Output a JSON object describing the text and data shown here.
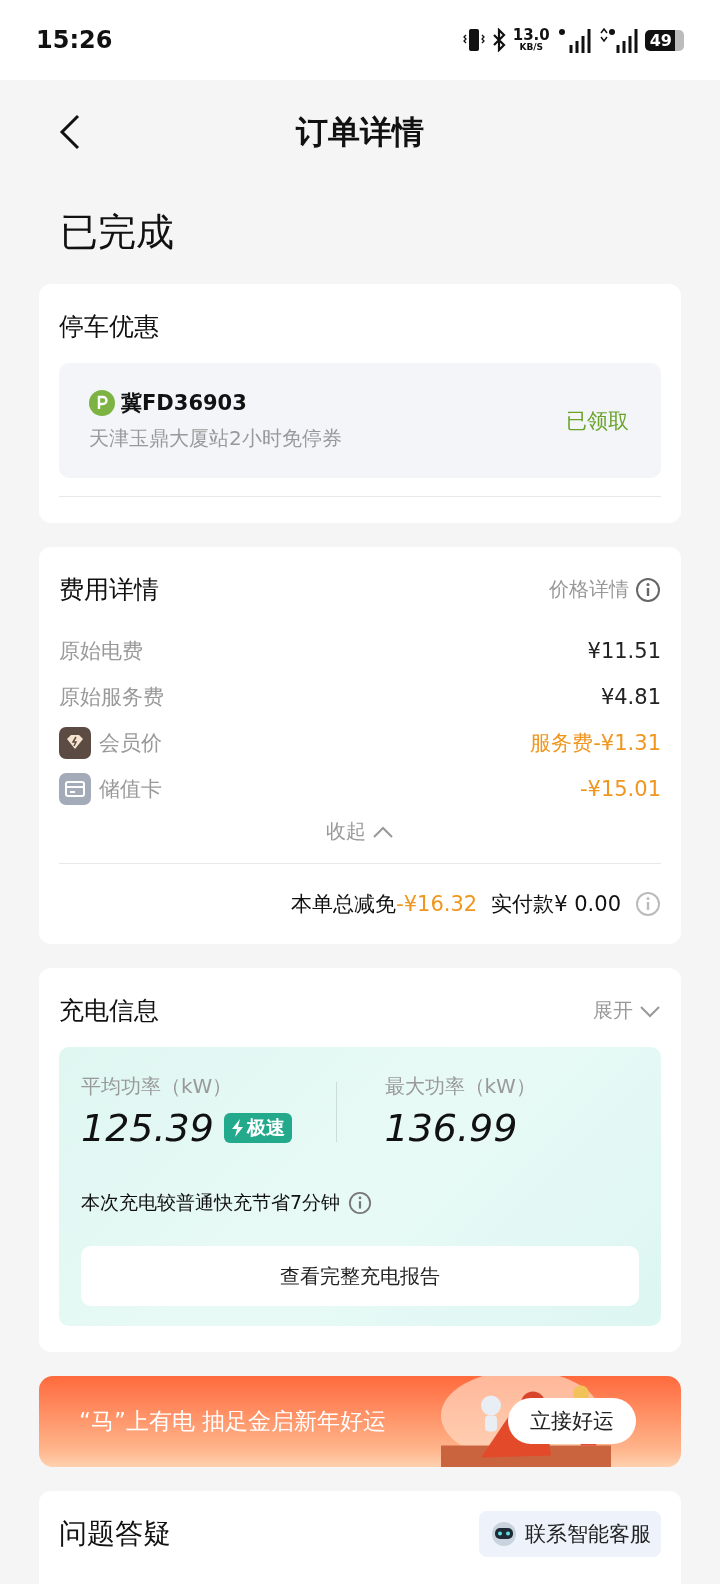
{
  "status_bar": {
    "time": "15:26",
    "speed": "13.0",
    "speed_unit": "KB/S",
    "battery": "49"
  },
  "header": {
    "title": "订单详情"
  },
  "order_status": "已完成",
  "parking": {
    "title": "停车优惠",
    "plate": "冀FD36903",
    "description": "天津玉鼎大厦站2小时免停券",
    "status": "已领取"
  },
  "fees": {
    "title": "费用详情",
    "link": "价格详情",
    "rows": [
      {
        "kind": "plain",
        "label": "原始电费",
        "value": "¥11.51",
        "discount": false
      },
      {
        "kind": "plain",
        "label": "原始服务费",
        "value": "¥4.81",
        "discount": false
      },
      {
        "kind": "member",
        "label": "会员价",
        "value": "服务费-¥1.31",
        "discount": true
      },
      {
        "kind": "stored_value",
        "label": "储值卡",
        "value": "-¥15.01",
        "discount": true
      }
    ],
    "toggle": {
      "label": "收起",
      "expanded": true
    },
    "total_label": "本单总减免",
    "total_value": "-¥16.32",
    "paid_label": "实付款¥ 0.00"
  },
  "charging": {
    "title": "充电信息",
    "toggle": {
      "label": "展开",
      "expanded": false
    },
    "avg_label": "平均功率（kW）",
    "avg_value": "125.39",
    "badge": "极速",
    "max_label": "最大功率（kW）",
    "max_value": "136.99",
    "note": "本次充电较普通快充节省7分钟",
    "report_button": "查看完整充电报告"
  },
  "banner": {
    "text": "“马”上有电 抽足金启新年好运",
    "button": "立接好运"
  },
  "faq": {
    "title": "问题答疑",
    "service_button": "联系智能客服"
  }
}
